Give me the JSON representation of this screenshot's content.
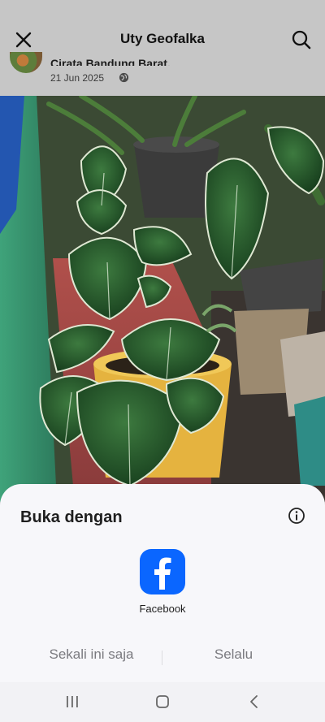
{
  "header": {
    "title": "Uty Geofalka",
    "close_icon": "close-icon",
    "search_icon": "search-icon"
  },
  "post": {
    "location": "Cirata Bandung Barat.",
    "date": "21 Jun 2025",
    "privacy_icon": "globe-icon"
  },
  "photo": {
    "subject": "photo"
  },
  "sheet": {
    "title": "Buka dengan",
    "info_icon": "info-icon",
    "app": {
      "label": "Facebook",
      "icon": "facebook-icon",
      "brand_color": "#0a66ff"
    },
    "once_label": "Sekali ini saja",
    "always_label": "Selalu"
  },
  "navbar": {
    "recents_icon": "recents-icon",
    "home_icon": "home-icon",
    "back_icon": "back-icon"
  }
}
